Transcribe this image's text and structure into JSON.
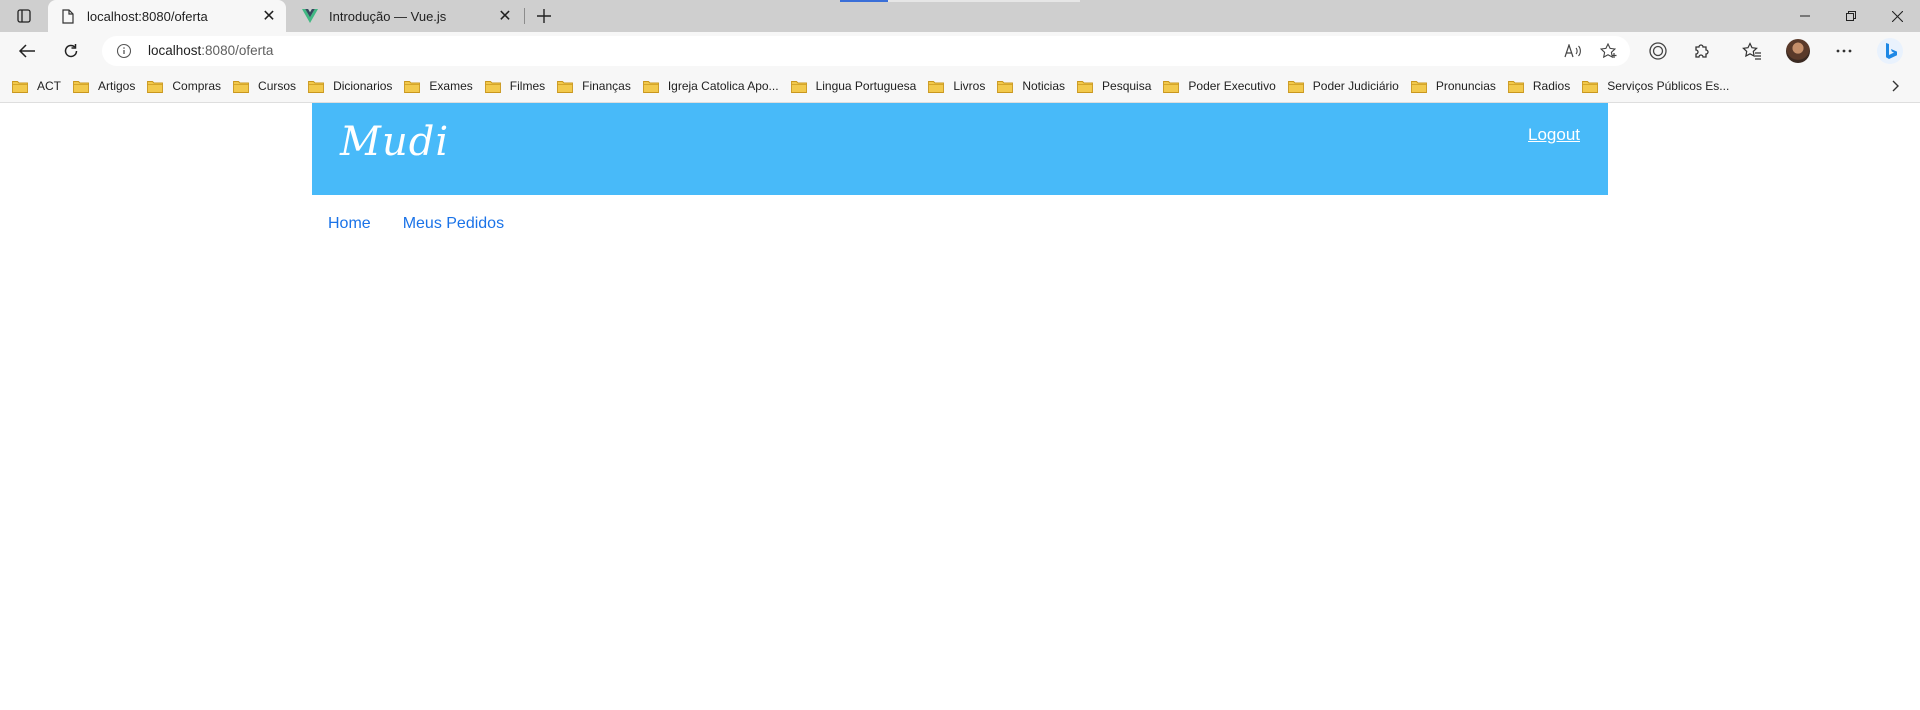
{
  "browser": {
    "tabs": [
      {
        "title": "localhost:8080/oferta",
        "active": true,
        "icon": "page-icon"
      },
      {
        "title": "Introdução — Vue.js",
        "active": false,
        "icon": "vue-logo-icon"
      }
    ],
    "address_bar": {
      "host": "localhost",
      "path": ":8080/oferta"
    },
    "bookmarks": [
      "ACT",
      "Artigos",
      "Compras",
      "Cursos",
      "Dicionarios",
      "Exames",
      "Filmes",
      "Finanças",
      "Igreja Catolica Apo...",
      "Lingua Portuguesa",
      "Livros",
      "Noticias",
      "Pesquisa",
      "Poder Executivo",
      "Poder Judiciário",
      "Pronuncias",
      "Radios",
      "Serviços Públicos Es..."
    ],
    "colors": {
      "tabstrip": "#cfcfcf",
      "toolbar": "#f7f7f7",
      "folder": "#f2c94c",
      "accent": "#3a6fd8",
      "bing": "#1e88e5"
    }
  },
  "site": {
    "logo": "Mudi",
    "logout_label": "Logout",
    "nav": [
      {
        "label": "Home"
      },
      {
        "label": "Meus Pedidos"
      }
    ],
    "colors": {
      "header_bg": "#48baf9",
      "link": "#1a73e8"
    }
  }
}
